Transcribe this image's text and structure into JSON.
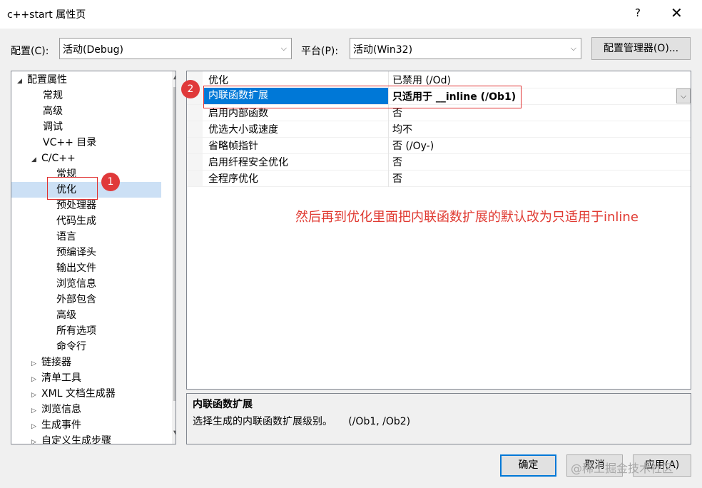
{
  "window": {
    "title": "c++start 属性页",
    "help_label": "?",
    "close_label": "✕"
  },
  "config": {
    "label": "配置(C):",
    "value": "活动(Debug)"
  },
  "platform": {
    "label": "平台(P):",
    "value": "活动(Win32)"
  },
  "config_manager_button": "配置管理器(O)...",
  "tree": {
    "root": "配置属性",
    "items": [
      "常规",
      "高级",
      "调试",
      "VC++ 目录"
    ],
    "cpp": "C/C++",
    "cpp_items": [
      "常规",
      "优化",
      "预处理器",
      "代码生成",
      "语言",
      "预编译头",
      "输出文件",
      "浏览信息",
      "外部包含",
      "高级",
      "所有选项",
      "命令行"
    ],
    "collapsed": [
      "链接器",
      "清单工具",
      "XML 文档生成器",
      "浏览信息",
      "生成事件",
      "自定义生成步骤"
    ]
  },
  "grid": {
    "rows": [
      {
        "key": "优化",
        "value": "已禁用 (/Od)"
      },
      {
        "key": "内联函数扩展",
        "value": "只适用于 __inline (/Ob1)"
      },
      {
        "key": "启用内部函数",
        "value": "否"
      },
      {
        "key": "优选大小或速度",
        "value": "均不"
      },
      {
        "key": "省略帧指针",
        "value": "否 (/Oy-)"
      },
      {
        "key": "启用纤程安全优化",
        "value": "否"
      },
      {
        "key": "全程序优化",
        "value": "否"
      }
    ]
  },
  "description": {
    "title": "内联函数扩展",
    "text": "选择生成的内联函数扩展级别。     (/Ob1, /Ob2)"
  },
  "annotations": {
    "badge1": "1",
    "badge2": "2",
    "note": "然后再到优化里面把内联函数扩展的默认改为只适用于inline",
    "color": "#e03a32"
  },
  "buttons": {
    "ok": "确定",
    "cancel": "取消",
    "apply": "应用(A)"
  },
  "watermark": "@稀土掘金技术社区"
}
